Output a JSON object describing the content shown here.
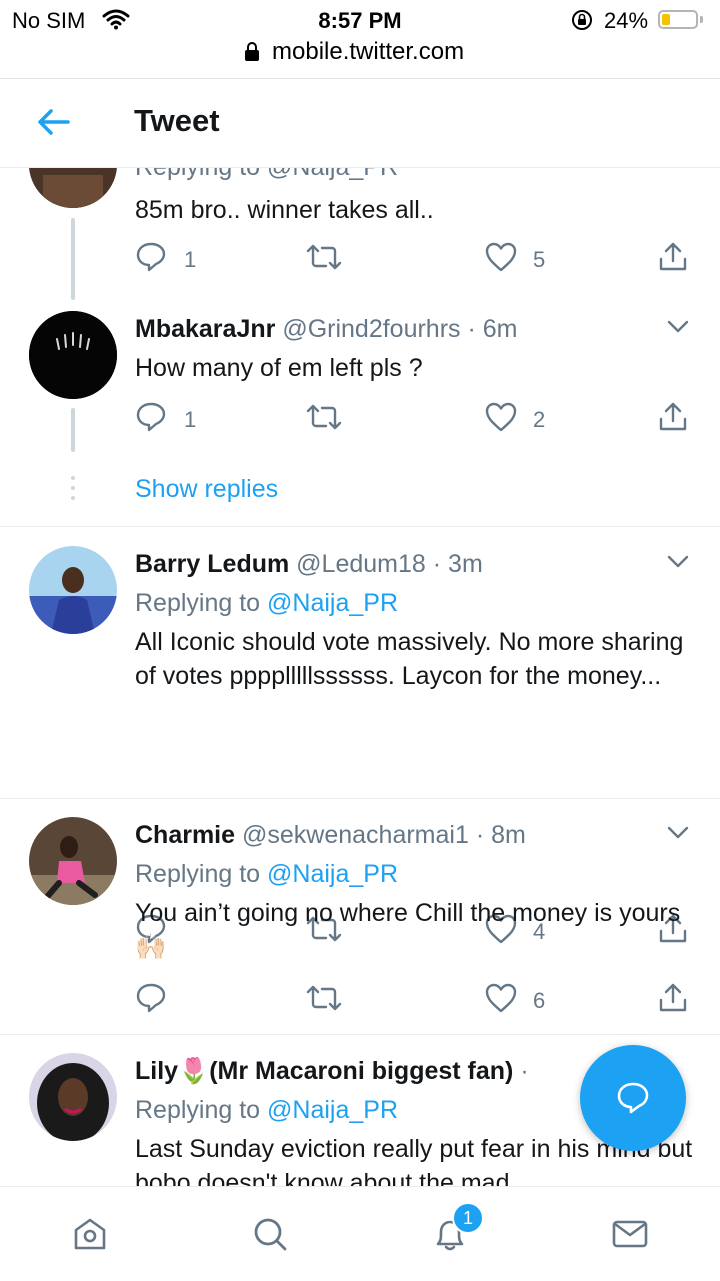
{
  "status_bar": {
    "carrier": "No SIM",
    "time": "8:57 PM",
    "battery_percent": "24%",
    "battery_level": 0.24,
    "url": "mobile.twitter.com"
  },
  "header": {
    "title": "Tweet"
  },
  "tweets": [
    {
      "partial_replying_text": "Replying to @Naija_PR",
      "text": "85m bro.. winner takes all..",
      "reply_count": "1",
      "like_count": "5"
    },
    {
      "name": "MbakaraJnr",
      "handle": "@Grind2fourhrs",
      "separator": "·",
      "age": "6m",
      "text": "How many of em left pls ?",
      "reply_count": "1",
      "like_count": "2",
      "show_replies": "Show replies"
    },
    {
      "name": "Barry Ledum",
      "handle": "@Ledum18",
      "separator": "·",
      "age": "3m",
      "replying_prefix": "Replying to",
      "replying_mention": "@Naija_PR",
      "text": "All Iconic should vote massively. No more sharing of votes pppplllllssssss. Laycon for the money...",
      "like_count": "4"
    },
    {
      "name": "Charmie",
      "handle": "@sekwenacharmai1",
      "separator": "·",
      "age": "8m",
      "replying_prefix": "Replying to",
      "replying_mention": "@Naija_PR",
      "text": "You ain’t going no where Chill the money is yours 🙌🏻",
      "like_count": "6"
    },
    {
      "name": "Lily🌷(Mr Macaroni biggest fan)",
      "separator": "·",
      "replying_prefix": "Replying to",
      "replying_mention": "@Naija_PR",
      "text": "Last Sunday eviction really put fear in his mind but bobo doesn't know about the mad"
    }
  ],
  "bottom_nav": {
    "notifications_badge": "1"
  },
  "colors": {
    "accent": "#1da1f2",
    "secondary_text": "#657786",
    "primary_text": "#14171a",
    "divider": "#e6ecf0"
  },
  "icons": [
    "wifi-icon",
    "rotation-lock-icon",
    "battery-icon",
    "padlock-icon",
    "back-arrow-icon",
    "reply-icon",
    "retweet-icon",
    "like-icon",
    "share-icon",
    "chevron-down-icon",
    "compose-reply-icon",
    "home-icon",
    "search-icon",
    "notifications-icon",
    "messages-icon"
  ]
}
